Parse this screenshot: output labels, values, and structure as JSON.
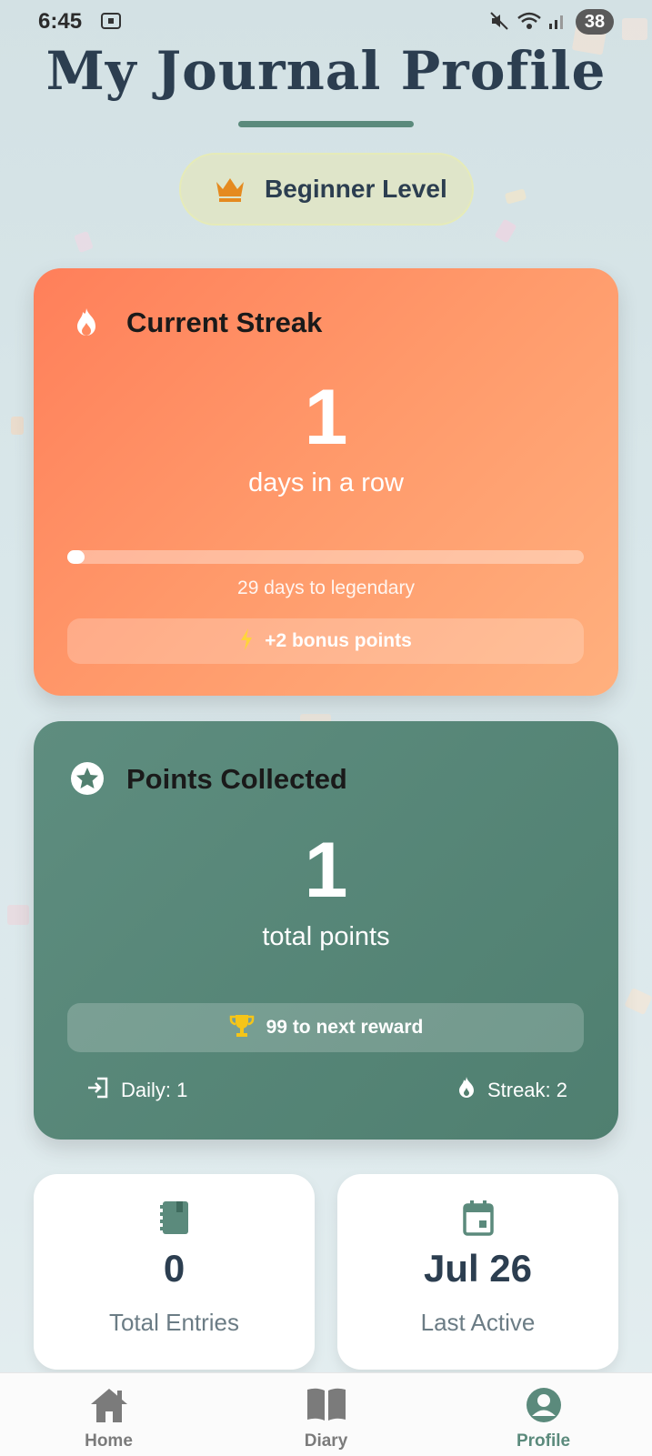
{
  "status_bar": {
    "time": "6:45",
    "battery": "38"
  },
  "header": {
    "title": "My Journal Profile",
    "level": "Beginner Level"
  },
  "streak_card": {
    "title": "Current Streak",
    "value": "1",
    "unit_label": "days in a row",
    "progress": 0.033,
    "progress_caption": "29 days to legendary",
    "bonus": "+2 bonus points"
  },
  "points_card": {
    "title": "Points Collected",
    "value": "1",
    "unit_label": "total points",
    "reward": "99 to next reward",
    "daily": "Daily: 1",
    "streak": "Streak: 2"
  },
  "stats": {
    "entries": {
      "value": "0",
      "label": "Total Entries"
    },
    "last_active": {
      "value": "Jul 26",
      "label": "Last Active"
    }
  },
  "nav": {
    "items": [
      {
        "label": "Home"
      },
      {
        "label": "Diary"
      },
      {
        "label": "Profile"
      }
    ],
    "active_color": "#5b8a7c"
  },
  "colors": {
    "streak_accent": "#ff8a60",
    "points_accent": "#5b8a7c",
    "crown": "#e58a1f",
    "trophy": "#f5c518"
  }
}
